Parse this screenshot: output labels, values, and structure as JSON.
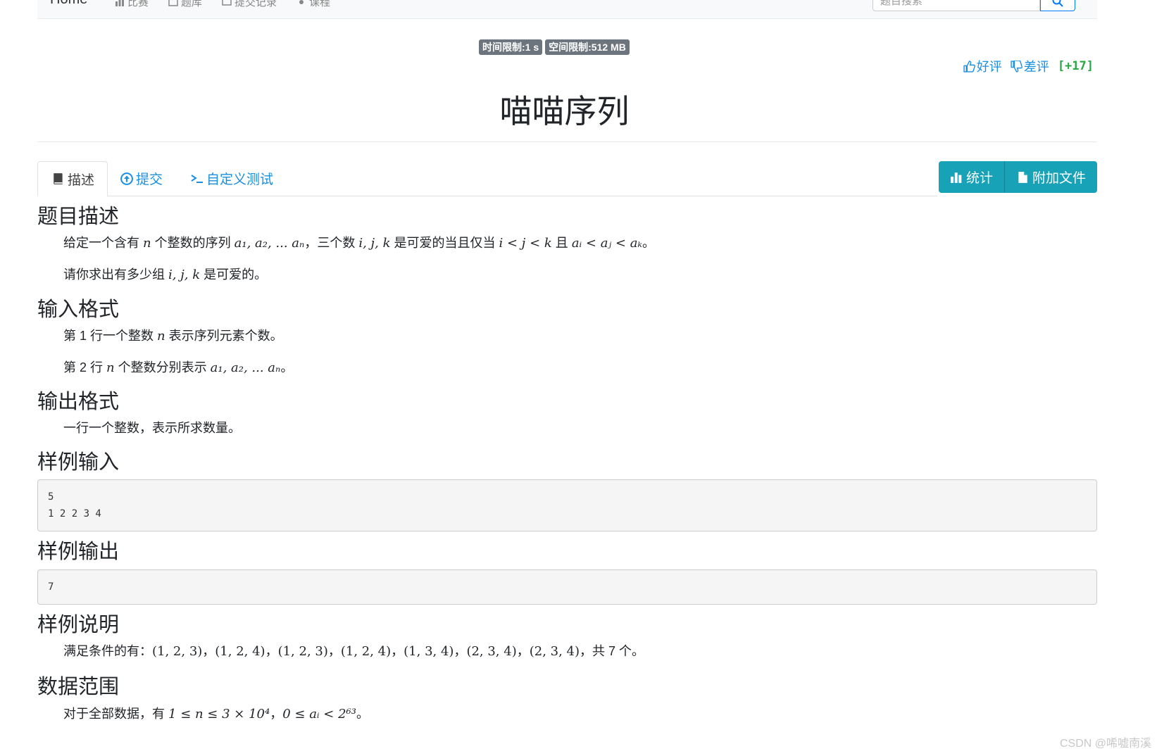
{
  "navbar": {
    "brand": "Home",
    "links": [
      "比赛",
      "题库",
      "提交记录",
      "课程"
    ],
    "search_placeholder": "题目搜索"
  },
  "limits": {
    "time": "时间限制:1 s",
    "memory": "空间限制:512 MB"
  },
  "votes": {
    "up_label": "好评",
    "down_label": "差评",
    "score": "[+17]"
  },
  "problem": {
    "title": "喵喵序列"
  },
  "tabs": [
    {
      "label": "描述"
    },
    {
      "label": "提交"
    },
    {
      "label": "自定义测试"
    }
  ],
  "actions": {
    "stats_label": "统计",
    "attach_label": "附加文件"
  },
  "sections": {
    "desc_title": "题目描述",
    "input_title": "输入格式",
    "output_title": "输出格式",
    "sample_in_title": "样例输入",
    "sample_out_title": "样例输出",
    "sample_expl_title": "样例说明",
    "range_title": "数据范围"
  },
  "text": {
    "desc_p1_a": "给定一个含有 ",
    "desc_p1_b": " 个整数的序列 ",
    "desc_p1_c": "，三个数 ",
    "desc_p1_d": " 是可爱的当且仅当 ",
    "desc_p1_e": " 且 ",
    "desc_p1_f": "。",
    "desc_p2_a": "请你求出有多少组 ",
    "desc_p2_b": " 是可爱的。",
    "input_p1_a": "第 1 行一个整数 ",
    "input_p1_b": " 表示序列元素个数。",
    "input_p2_a": "第 2 行 ",
    "input_p2_b": " 个整数分别表示 ",
    "input_p2_c": "。",
    "output_p1": "一行一个整数，表示所求数量。",
    "expl_a": "满足条件的有：",
    "expl_tuples": "(1, 2, 3)，(1, 2, 4)，(1, 2, 3)，(1, 2, 4)，(1, 3, 4)，(2, 3, 4)，(2, 3, 4)",
    "expl_b": "，共 7 个。",
    "range_a": "对于全部数据，有 ",
    "range_b": "，",
    "range_c": "。"
  },
  "math": {
    "n": "n",
    "seq": "a₁, a₂, ... aₙ",
    "ijk": "i, j, k",
    "ineq1": "i < j < k",
    "ineq2": "aᵢ < aⱼ < aₖ",
    "n_bound": "1 ≤ n ≤ 3 × 10⁴",
    "a_bound": "0 ≤ aᵢ < 2⁶³"
  },
  "samples": {
    "input": "5\n1 2 2 3 4",
    "output": "7"
  },
  "watermark": "CSDN @唏嘘南溪"
}
